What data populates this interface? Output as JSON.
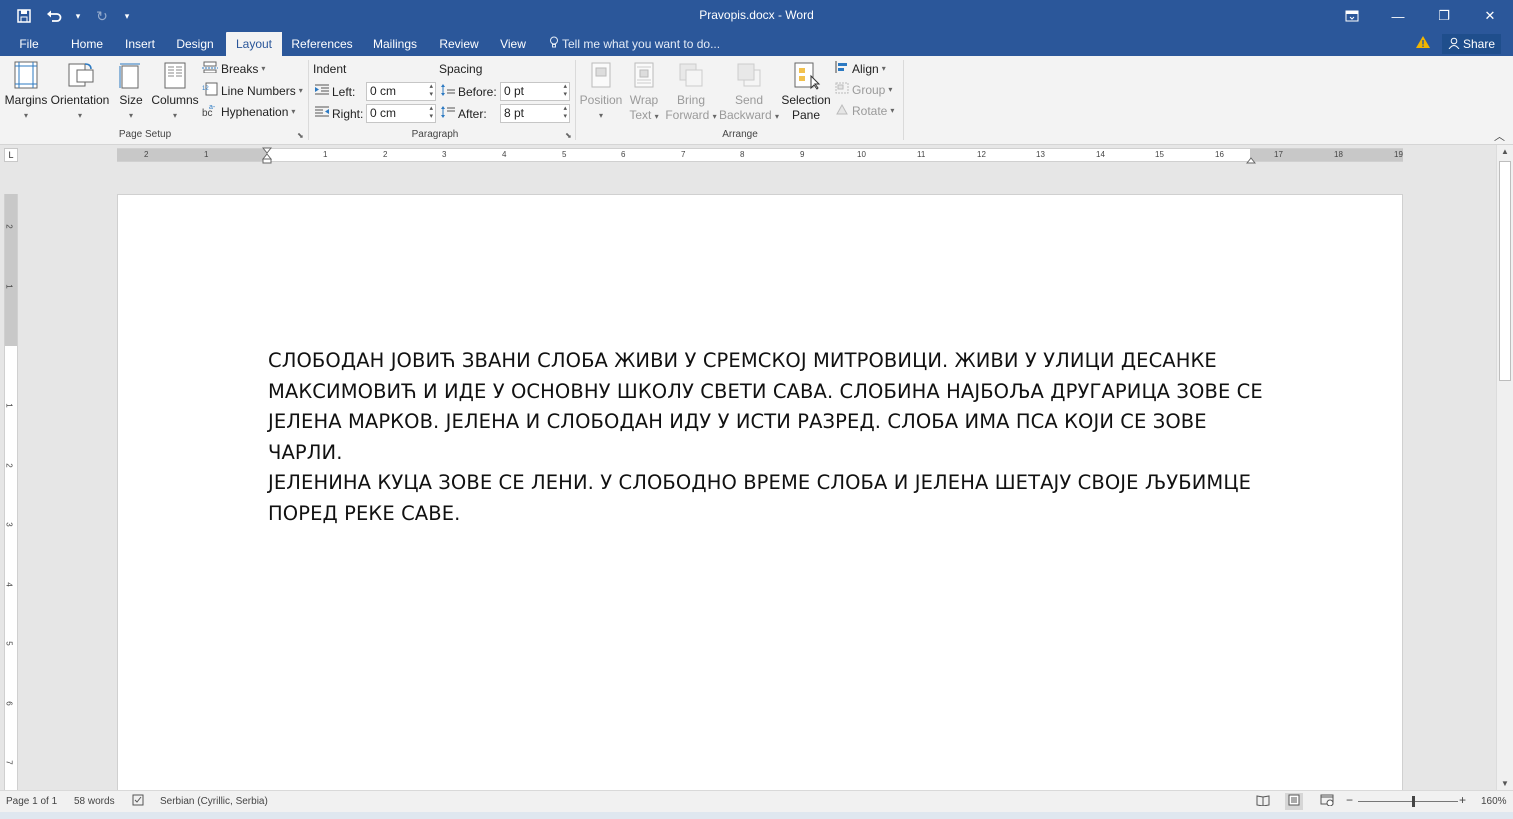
{
  "window": {
    "title": "Pravopis.docx - Word",
    "controls": {
      "ribbon_display": "▣",
      "minimize": "—",
      "restore": "❐",
      "close": "✕"
    }
  },
  "qat": {
    "save": "▣",
    "undo": "↶",
    "undo_dd": "▾",
    "redo": "↻",
    "customize": "▾"
  },
  "tabs": [
    {
      "label": "File"
    },
    {
      "label": "Home"
    },
    {
      "label": "Insert"
    },
    {
      "label": "Design"
    },
    {
      "label": "Layout"
    },
    {
      "label": "References"
    },
    {
      "label": "Mailings"
    },
    {
      "label": "Review"
    },
    {
      "label": "View"
    }
  ],
  "active_tab": "Layout",
  "tell_me": "Tell me what you want to do...",
  "share": "Share",
  "ribbon": {
    "page_setup": {
      "label": "Page Setup",
      "margins": "Margins",
      "orientation": "Orientation",
      "size": "Size",
      "columns": "Columns",
      "breaks": "Breaks",
      "line_numbers": "Line Numbers",
      "hyphenation": "Hyphenation"
    },
    "paragraph": {
      "label": "Paragraph",
      "indent_header": "Indent",
      "spacing_header": "Spacing",
      "left_label": "Left:",
      "left_value": "0 cm",
      "right_label": "Right:",
      "right_value": "0 cm",
      "before_label": "Before:",
      "before_value": "0 pt",
      "after_label": "After:",
      "after_value": "8 pt"
    },
    "arrange": {
      "label": "Arrange",
      "position": "Position",
      "wrap_text_1": "Wrap",
      "wrap_text_2": "Text",
      "bring_forward_1": "Bring",
      "bring_forward_2": "Forward",
      "send_backward_1": "Send",
      "send_backward_2": "Backward",
      "selection_pane_1": "Selection",
      "selection_pane_2": "Pane",
      "align": "Align",
      "group": "Group",
      "rotate": "Rotate"
    }
  },
  "ruler": {
    "tab_selector": "L",
    "h_left_ticks": [
      "2",
      "1"
    ],
    "h_ticks": [
      "1",
      "2",
      "3",
      "4",
      "5",
      "6",
      "7",
      "8",
      "9",
      "10",
      "11",
      "12",
      "13",
      "14",
      "15",
      "16"
    ],
    "h_right_ticks": [
      "17",
      "18",
      "19"
    ],
    "v_top_ticks": [
      "2",
      "1"
    ],
    "v_ticks": [
      "1",
      "2",
      "3",
      "4",
      "5",
      "6",
      "7"
    ]
  },
  "document": {
    "lines": [
      "СЛОБОДАН ЈОВИЋ ЗВАНИ СЛОБА ЖИВИ У СРЕМСКОЈ МИТРОВИЦИ. ЖИВИ У УЛИЦИ ДЕСАНКЕ",
      "МАКСИМОВИЋ И ИДЕ У ОСНОВНУ ШКОЛУ СВЕТИ САВА. СЛОБИНА НАЈБОЉА ДРУГАРИЦА ЗОВЕ СЕ",
      "ЈЕЛЕНА МАРКОВ. ЈЕЛЕНА И СЛОБОДАН ИДУ У ИСТИ РАЗРЕД. СЛОБА ИМА ПСА КОЈИ СЕ ЗОВЕ ЧАРЛИ.",
      "ЈЕЛЕНИНА КУЦА ЗОВЕ СЕ ЛЕНИ. У СЛОБОДНО ВРЕМЕ СЛОБА И ЈЕЛЕНА ШЕТАЈУ СВОЈЕ ЉУБИМЦЕ",
      "ПОРЕД РЕКЕ САВЕ."
    ]
  },
  "status": {
    "page": "Page 1 of 1",
    "words": "58 words",
    "language": "Serbian (Cyrillic, Serbia)",
    "zoom": "160%",
    "zoom_percent": 160
  },
  "colors": {
    "accent": "#2b579a",
    "ribbon_bg": "#f3f3f3",
    "page_bg": "#e6e6e6"
  }
}
